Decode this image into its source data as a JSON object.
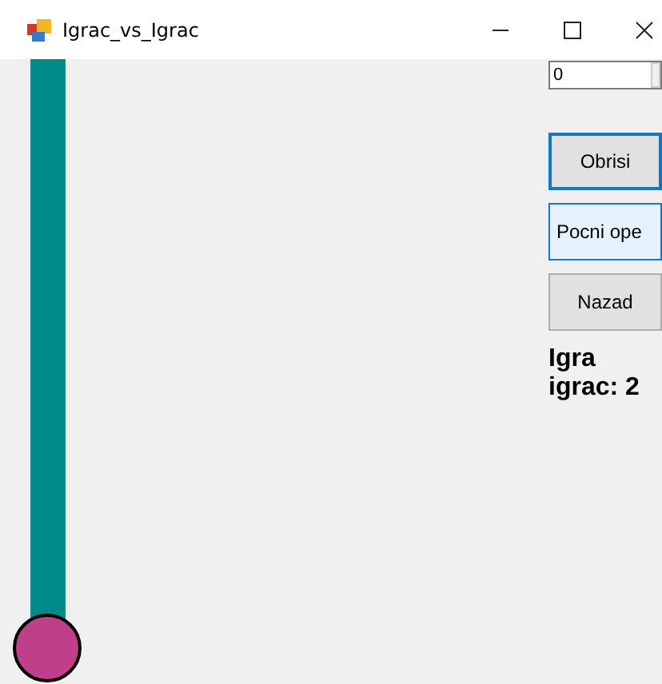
{
  "window": {
    "title": "Igrac_vs_Igrac"
  },
  "counter": {
    "value": "0"
  },
  "buttons": [
    {
      "label": "Obrisi",
      "focused": true,
      "hover": false
    },
    {
      "label": "Pocni ope",
      "focused": false,
      "hover": true
    },
    {
      "label": "Nazad",
      "focused": false,
      "hover": false
    }
  ],
  "status": {
    "line1": "Igra",
    "line2": "igrac: 2"
  }
}
